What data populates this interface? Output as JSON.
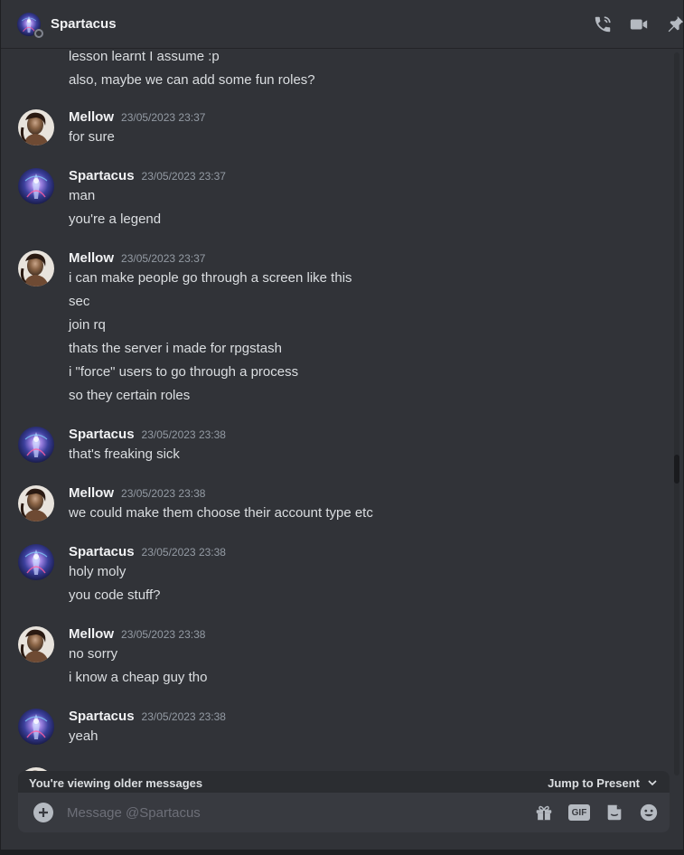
{
  "header": {
    "name": "Spartacus",
    "icons": [
      "phone-call-icon",
      "video-camera-icon",
      "pin-icon"
    ]
  },
  "messages": {
    "continuation": [
      "lesson learnt I assume :p",
      "also, maybe we can add some fun roles?"
    ],
    "groups": [
      {
        "author": "Mellow",
        "avatar": "mellow-avatar",
        "timestamp": "23/05/2023 23:37",
        "lines": [
          "for sure"
        ]
      },
      {
        "author": "Spartacus",
        "avatar": "spartacus-avatar",
        "timestamp": "23/05/2023 23:37",
        "lines": [
          "man",
          "you're a legend"
        ]
      },
      {
        "author": "Mellow",
        "avatar": "mellow-avatar",
        "timestamp": "23/05/2023 23:37",
        "lines": [
          "i can make people go through a screen like this",
          "sec",
          "join rq",
          "thats the server i made for rpgstash",
          "i \"force\" users to go through a process",
          "so they certain roles"
        ]
      },
      {
        "author": "Spartacus",
        "avatar": "spartacus-avatar",
        "timestamp": "23/05/2023 23:38",
        "lines": [
          "that's freaking sick"
        ]
      },
      {
        "author": "Mellow",
        "avatar": "mellow-avatar",
        "timestamp": "23/05/2023 23:38",
        "lines": [
          "we could make them choose their account type etc"
        ]
      },
      {
        "author": "Spartacus",
        "avatar": "spartacus-avatar",
        "timestamp": "23/05/2023 23:38",
        "lines": [
          "holy moly",
          "you code stuff?"
        ]
      },
      {
        "author": "Mellow",
        "avatar": "mellow-avatar",
        "timestamp": "23/05/2023 23:38",
        "lines": [
          "no sorry",
          "i know a cheap guy tho"
        ]
      },
      {
        "author": "Spartacus",
        "avatar": "spartacus-avatar",
        "timestamp": "23/05/2023 23:38",
        "lines": [
          "yeah"
        ]
      }
    ]
  },
  "older_bar": {
    "text": "You're viewing older messages",
    "jump_label": "Jump to Present"
  },
  "composer": {
    "placeholder": "Message @Spartacus",
    "icons": [
      "add-icon",
      "gift-icon",
      "gif-icon",
      "sticker-icon",
      "emoji-icon"
    ],
    "gif_label": "GIF"
  },
  "colors": {
    "background": "#313338",
    "composer": "#383a40",
    "text": "#dbdee1",
    "muted": "#949ba4"
  }
}
